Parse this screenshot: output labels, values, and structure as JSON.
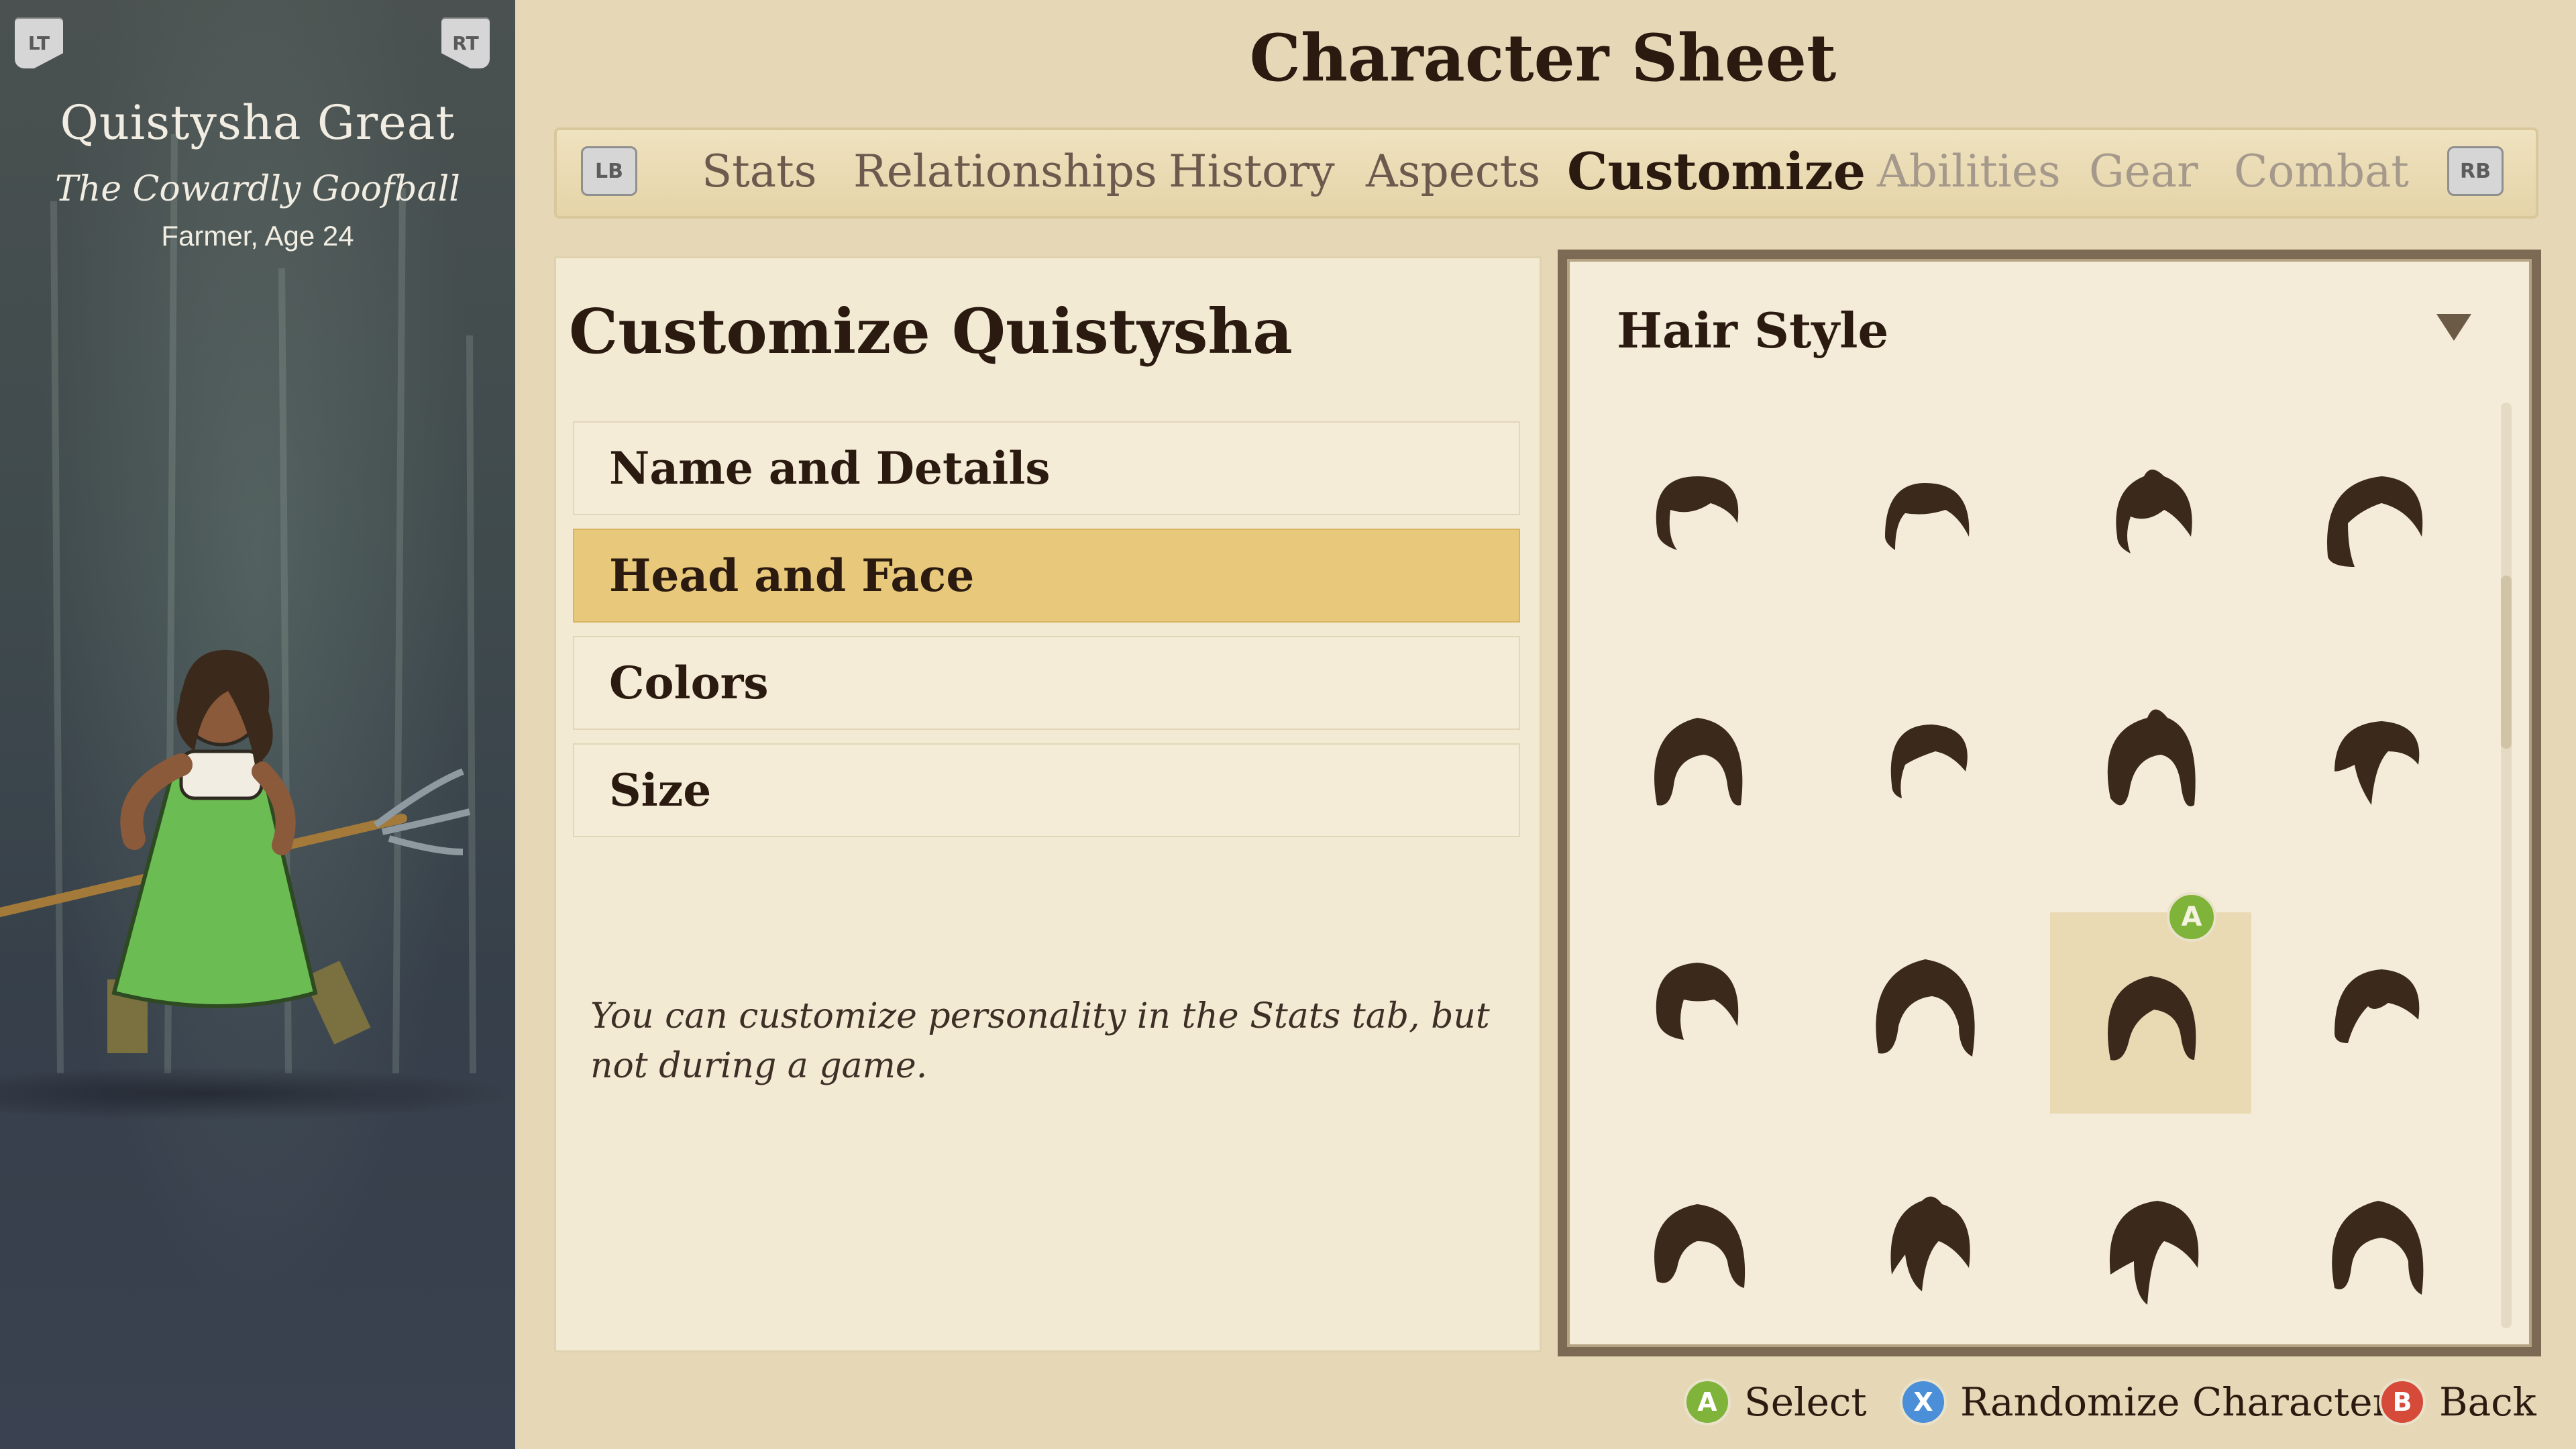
{
  "character": {
    "name": "Quistysha Great",
    "title": "The Cowardly Goofball",
    "subtitle": "Farmer, Age 24"
  },
  "triggers": {
    "left": "LT",
    "right": "RT"
  },
  "header": {
    "page_title": "Character Sheet",
    "bumper_left": "LB",
    "bumper_right": "RB",
    "tabs": [
      {
        "label": "Stats",
        "state": "enabled"
      },
      {
        "label": "Relationships",
        "state": "enabled"
      },
      {
        "label": "History",
        "state": "enabled"
      },
      {
        "label": "Aspects",
        "state": "enabled"
      },
      {
        "label": "Customize",
        "state": "active"
      },
      {
        "label": "Abilities",
        "state": "disabled"
      },
      {
        "label": "Gear",
        "state": "disabled"
      },
      {
        "label": "Combat",
        "state": "disabled"
      }
    ]
  },
  "customize": {
    "heading": "Customize Quistysha",
    "menu": [
      {
        "label": "Name and Details",
        "selected": false
      },
      {
        "label": "Head and Face",
        "selected": true
      },
      {
        "label": "Colors",
        "selected": false
      },
      {
        "label": "Size",
        "selected": false
      }
    ],
    "hint": "You can customize personality in the Stats tab, but not during a game."
  },
  "hair_style": {
    "title": "Hair Style",
    "selected_index": 10,
    "selected_badge": "A",
    "colors": {
      "hair": "#3b2a1c",
      "selected_bg": "#e9dab4"
    }
  },
  "footer": {
    "select_button": "A",
    "select_label": "Select",
    "randomize_button": "X",
    "randomize_label": "Randomize Character",
    "back_button": "B",
    "back_label": "Back"
  },
  "colors": {
    "accent_gold": "#e8c87a",
    "text_dark": "#2a1a10",
    "panel_bg": "#f3ead4"
  }
}
